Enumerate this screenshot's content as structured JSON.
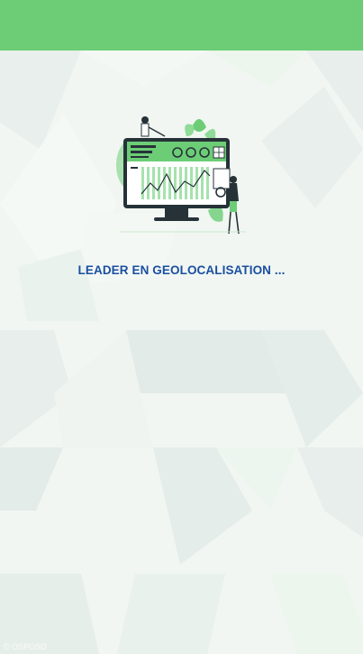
{
  "app_bar": {
    "color": "#6ccd76"
  },
  "splash": {
    "illustration_icon": "analytics-dashboard-illustration",
    "tagline": "LEADER EN GEOLOCALISATION ...",
    "tagline_color": "#1a4fa0"
  },
  "watermark": {
    "text": "© OSPOSD"
  }
}
